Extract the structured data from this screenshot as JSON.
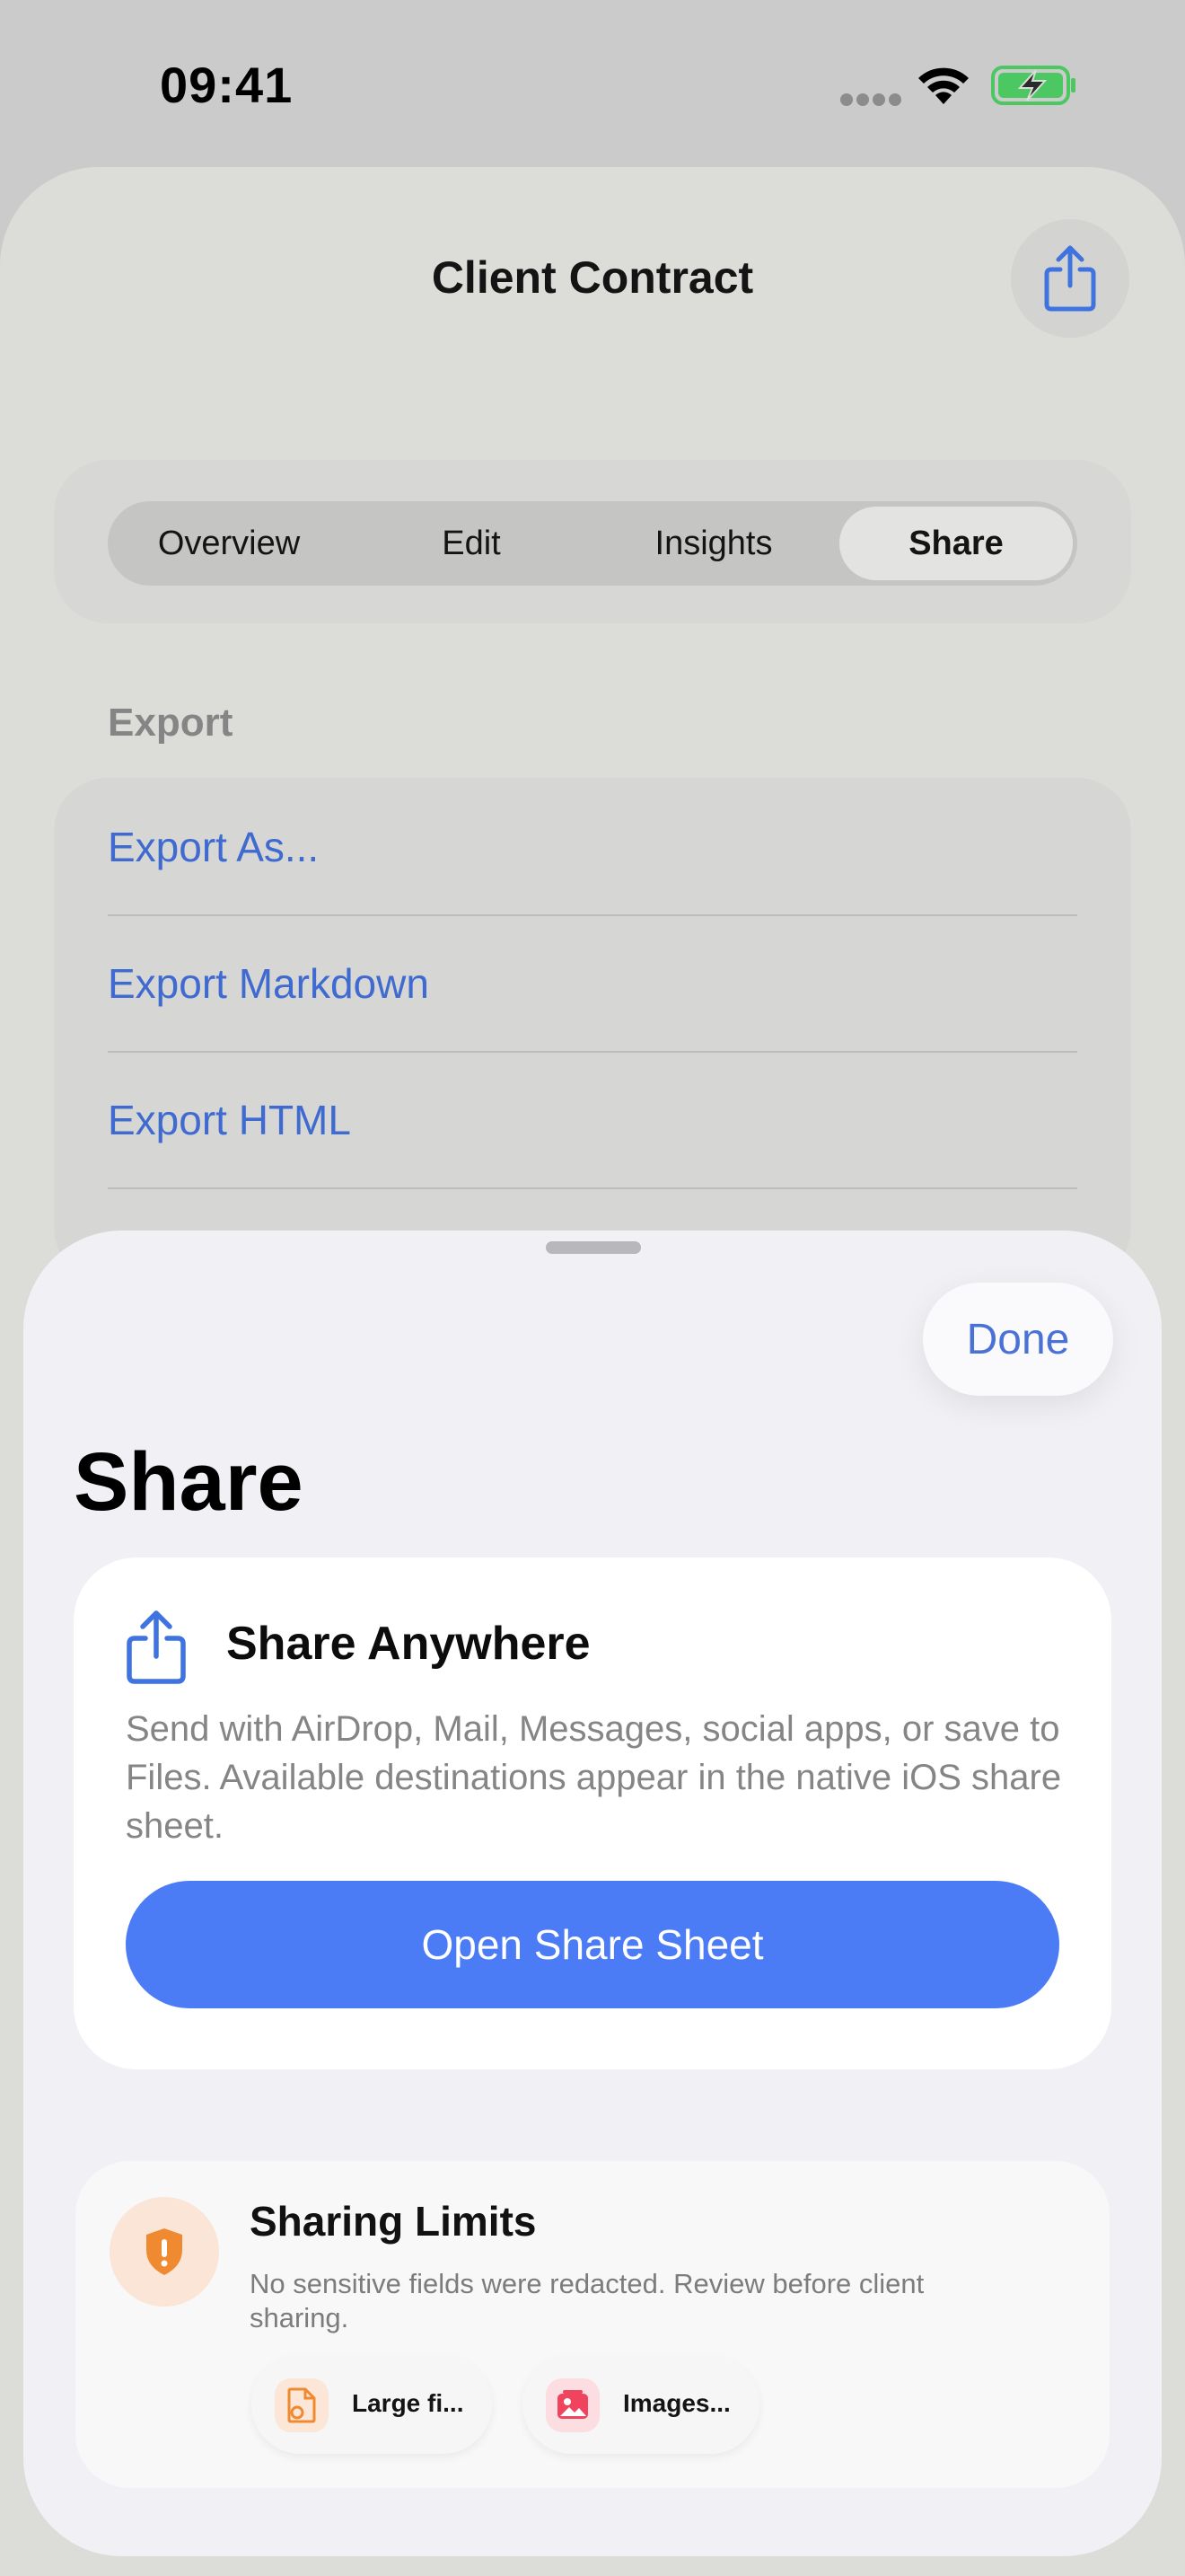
{
  "status_bar": {
    "time": "09:41"
  },
  "nav": {
    "title": "Client Contract",
    "share_icon": "share-icon"
  },
  "segments": [
    {
      "label": "Overview",
      "active": false
    },
    {
      "label": "Edit",
      "active": false
    },
    {
      "label": "Insights",
      "active": false
    },
    {
      "label": "Share",
      "active": true
    }
  ],
  "export": {
    "section_label": "Export",
    "items": [
      {
        "label": "Export As..."
      },
      {
        "label": "Export Markdown"
      },
      {
        "label": "Export HTML"
      }
    ]
  },
  "sheet": {
    "done_label": "Done",
    "title": "Share",
    "share_card": {
      "icon": "share-icon",
      "title": "Share Anywhere",
      "description": "Send with AirDrop, Mail, Messages, social apps, or save to Files. Available destinations appear in the native iOS share sheet.",
      "button_label": "Open Share Sheet"
    },
    "limits_card": {
      "icon": "shield-exclamation-icon",
      "title": "Sharing Limits",
      "description": "No sensitive fields were redacted. Review before client sharing.",
      "chips": [
        {
          "label": "Large fi...",
          "icon": "file-settings-icon"
        },
        {
          "label": "Images...",
          "icon": "image-icon"
        }
      ]
    }
  },
  "colors": {
    "accent": "#4b7cf5",
    "link": "#3f6ad0",
    "warning": "#f08a30",
    "image_chip": "#f0435e",
    "battery_green": "#4cc862"
  }
}
